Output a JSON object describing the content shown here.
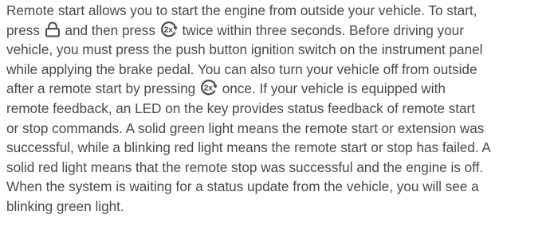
{
  "paragraph": {
    "line1": "Remote start allows you to start the engine from outside your vehicle. To start,",
    "line2_a": "press",
    "line2_b": "and then press",
    "line2_c": "twice within three seconds. Before driving your",
    "line3": "vehicle, you must press the push button ignition switch on the instrument panel",
    "line4": "while applying the brake pedal. You can also turn your vehicle off from outside",
    "line5_a": "after a remote start by pressing",
    "line5_b": "once. If your vehicle is equipped with",
    "line6": "remote feedback, an LED on the key provides status feedback of remote start",
    "line7": "or stop commands. A solid green light means the remote start or extension was",
    "line8": "successful, while a blinking red light means the remote start or stop has failed. A",
    "line9": "solid red light means that the remote stop was successful and the engine is off.",
    "line10": "When the system is waiting for a status update from the vehicle, you will see a",
    "line11": "blinking green light."
  },
  "icons": {
    "lock": "lock-icon",
    "remote_start": "remote-start-2x-icon",
    "remote_start_label": "2x"
  },
  "colors": {
    "text": "#4a4a4a"
  }
}
